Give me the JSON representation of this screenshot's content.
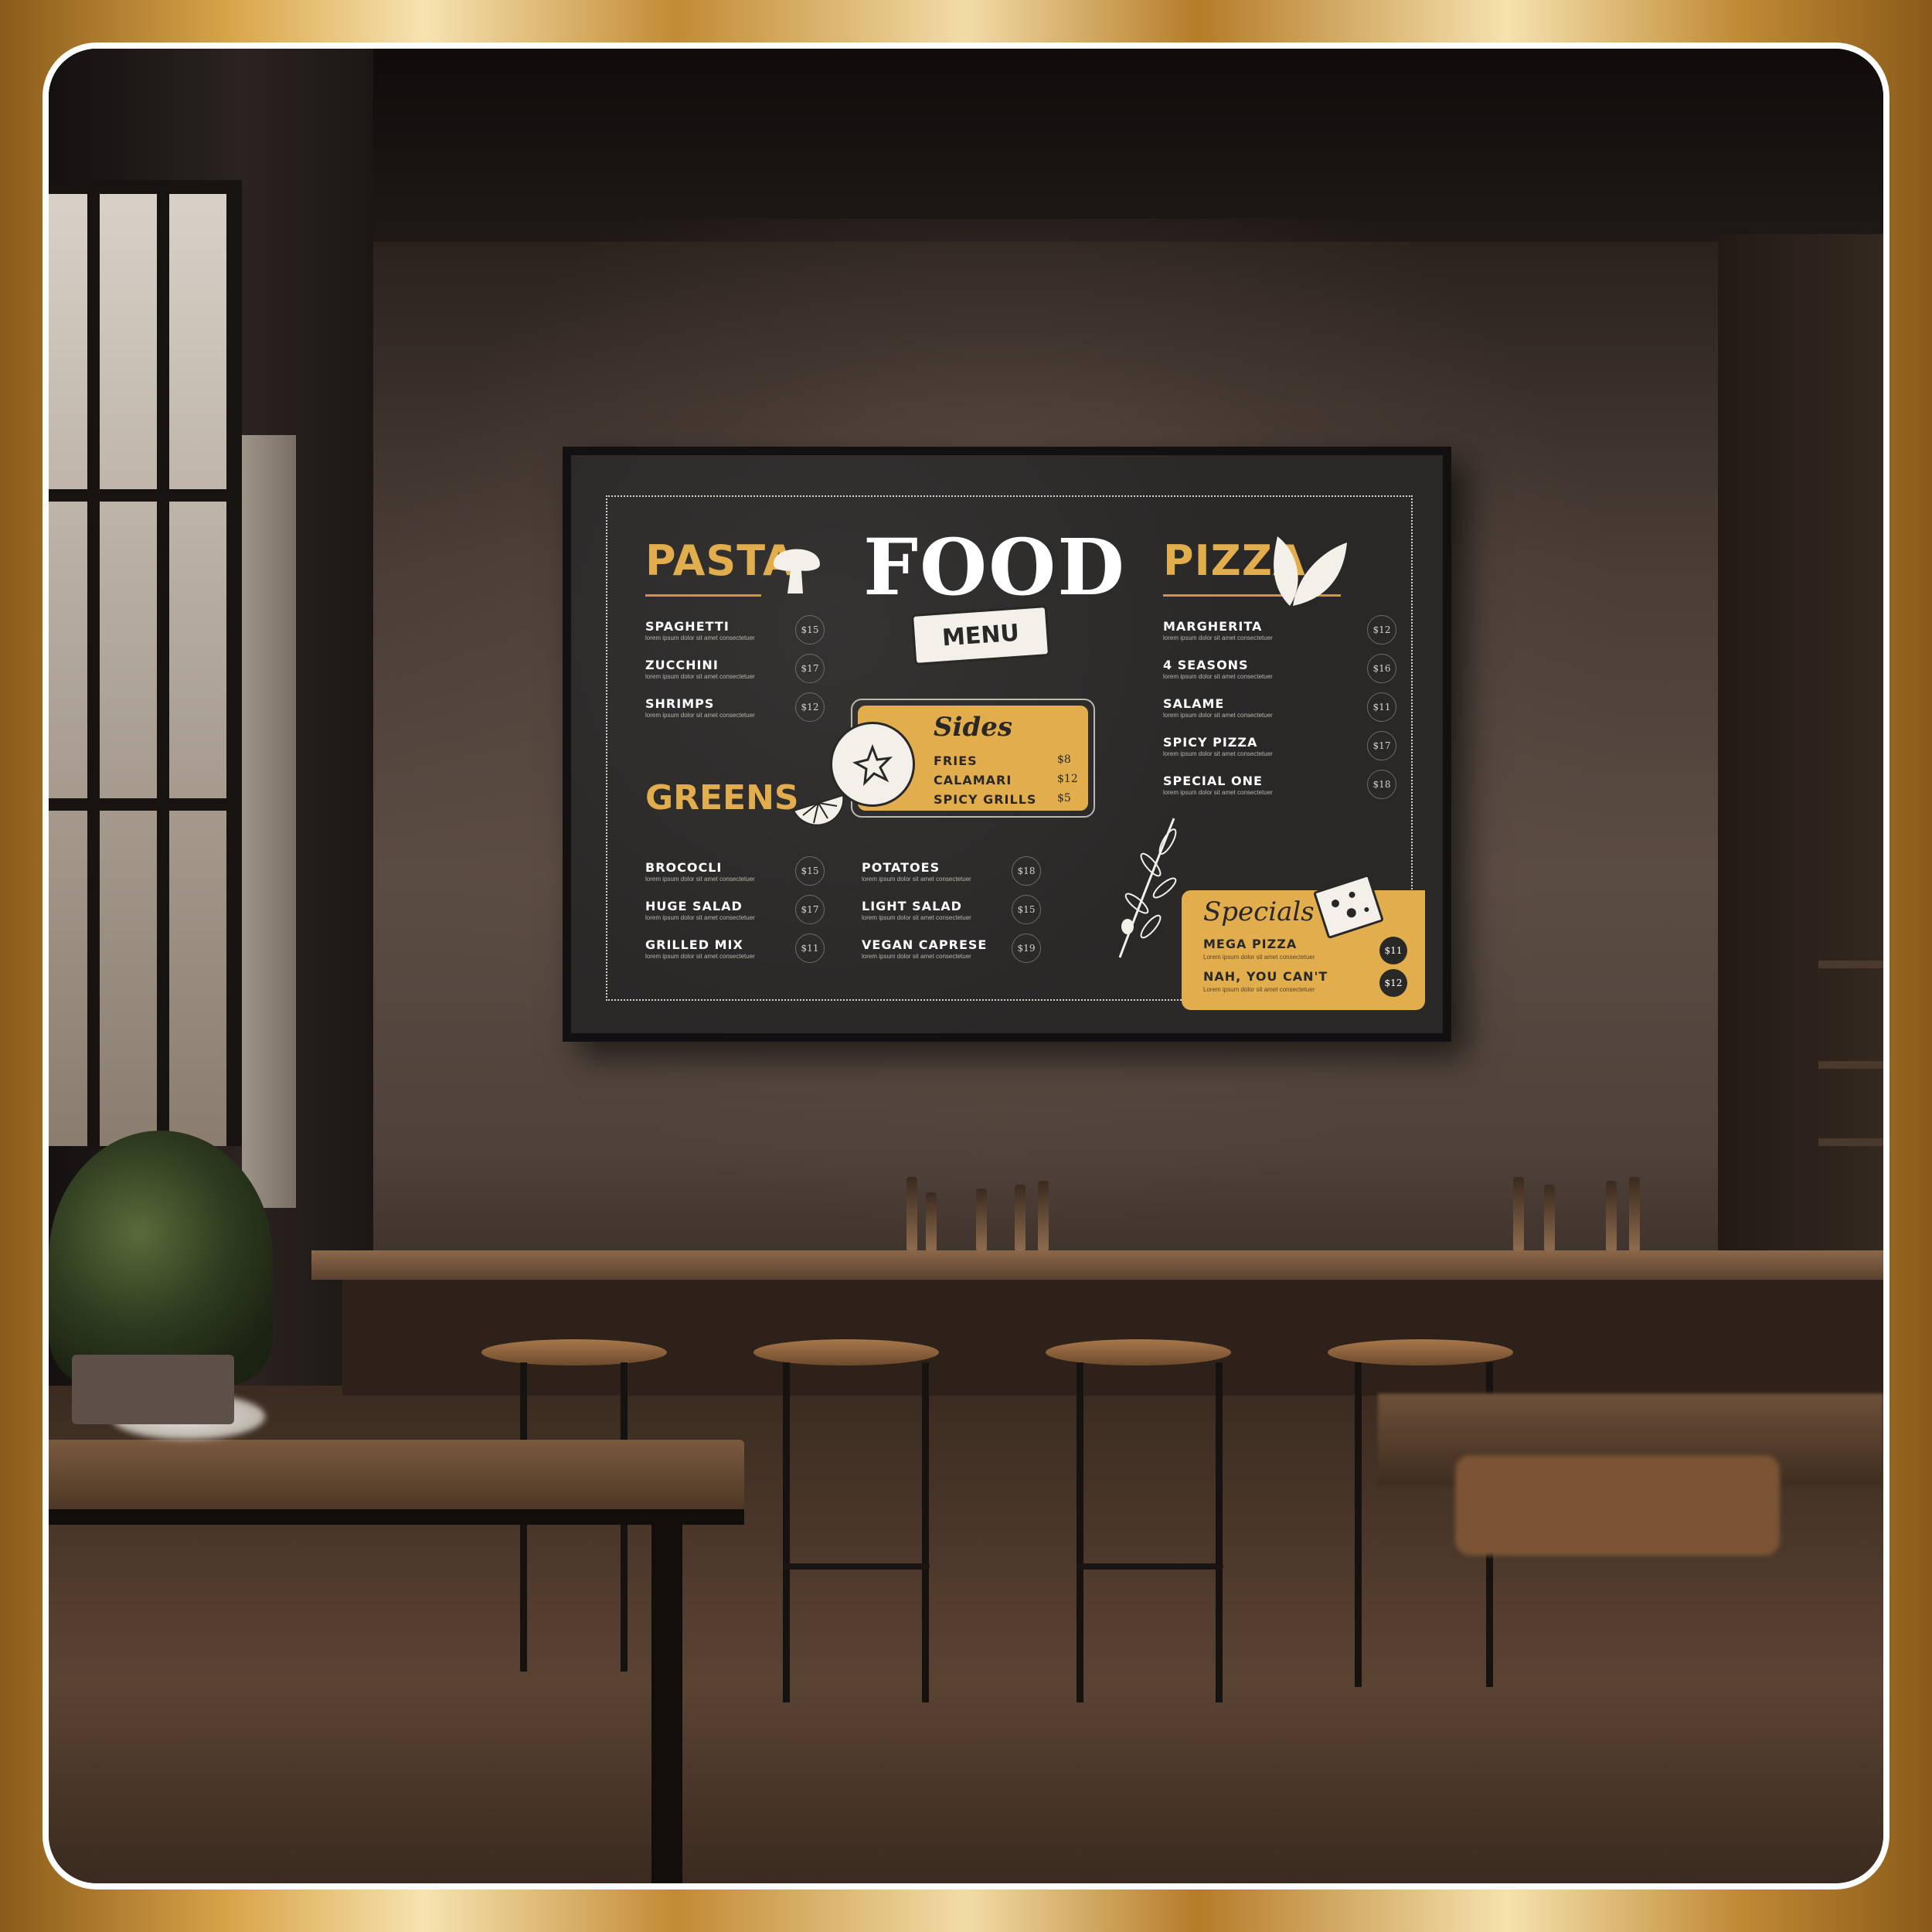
{
  "menu": {
    "title": "FOOD",
    "banner": "MENU",
    "accent_color": "#e2ae4d",
    "board_color": "#2a2827",
    "pasta": {
      "title": "PASTA",
      "items": [
        {
          "name": "SPAGHETTI",
          "desc": "lorem ipsum dolor sit amet consectetuer",
          "price": "$15"
        },
        {
          "name": "ZUCCHINI",
          "desc": "lorem ipsum dolor sit amet consectetuer",
          "price": "$17"
        },
        {
          "name": "SHRIMPS",
          "desc": "lorem ipsum dolor sit amet consectetuer",
          "price": "$12"
        }
      ]
    },
    "greens": {
      "title": "GREENS",
      "items": [
        {
          "name": "BROCOCLI",
          "desc": "lorem ipsum dolor sit amet consectetuer",
          "price": "$15"
        },
        {
          "name": "HUGE SALAD",
          "desc": "lorem ipsum dolor sit amet consectetuer",
          "price": "$17"
        },
        {
          "name": "GRILLED MIX",
          "desc": "lorem ipsum dolor sit amet consectetuer",
          "price": "$11"
        }
      ]
    },
    "middle": {
      "items": [
        {
          "name": "POTATOES",
          "desc": "lorem ipsum dolor sit amet consectetuer",
          "price": "$18"
        },
        {
          "name": "LIGHT SALAD",
          "desc": "lorem ipsum dolor sit amet consectetuer",
          "price": "$15"
        },
        {
          "name": "VEGAN CAPRESE",
          "desc": "lorem ipsum dolor sit amet consectetuer",
          "price": "$19"
        }
      ]
    },
    "sides": {
      "title": "Sides",
      "items": [
        {
          "name": "FRIES",
          "price": "$8"
        },
        {
          "name": "CALAMARI",
          "price": "$12"
        },
        {
          "name": "SPICY GRILLS",
          "price": "$5"
        }
      ]
    },
    "pizza": {
      "title": "PIZZA",
      "items": [
        {
          "name": "MARGHERITA",
          "desc": "lorem ipsum dolor sit amet consectetuer",
          "price": "$12"
        },
        {
          "name": "4 SEASONS",
          "desc": "lorem ipsum dolor sit amet consectetuer",
          "price": "$16"
        },
        {
          "name": "SALAME",
          "desc": "lorem ipsum dolor sit amet consectetuer",
          "price": "$11"
        },
        {
          "name": "SPICY PIZZA",
          "desc": "lorem ipsum dolor sit amet consectetuer",
          "price": "$17"
        },
        {
          "name": "SPECIAL ONE",
          "desc": "lorem ipsum dolor sit amet consectetuer",
          "price": "$18"
        }
      ]
    },
    "specials": {
      "title": "Specials",
      "items": [
        {
          "name": "MEGA PIZZA",
          "desc": "Lorem ipsum dolor sit amet consectetuer",
          "price": "$11"
        },
        {
          "name": "NAH, YOU CAN'T",
          "desc": "Lorem ipsum dolor sit amet consectetuer",
          "price": "$12"
        }
      ]
    },
    "icons": [
      "mushroom-icon",
      "leaf-icon",
      "lemon-icon",
      "tomato-icon",
      "olive-branch-icon",
      "cheese-icon"
    ]
  }
}
